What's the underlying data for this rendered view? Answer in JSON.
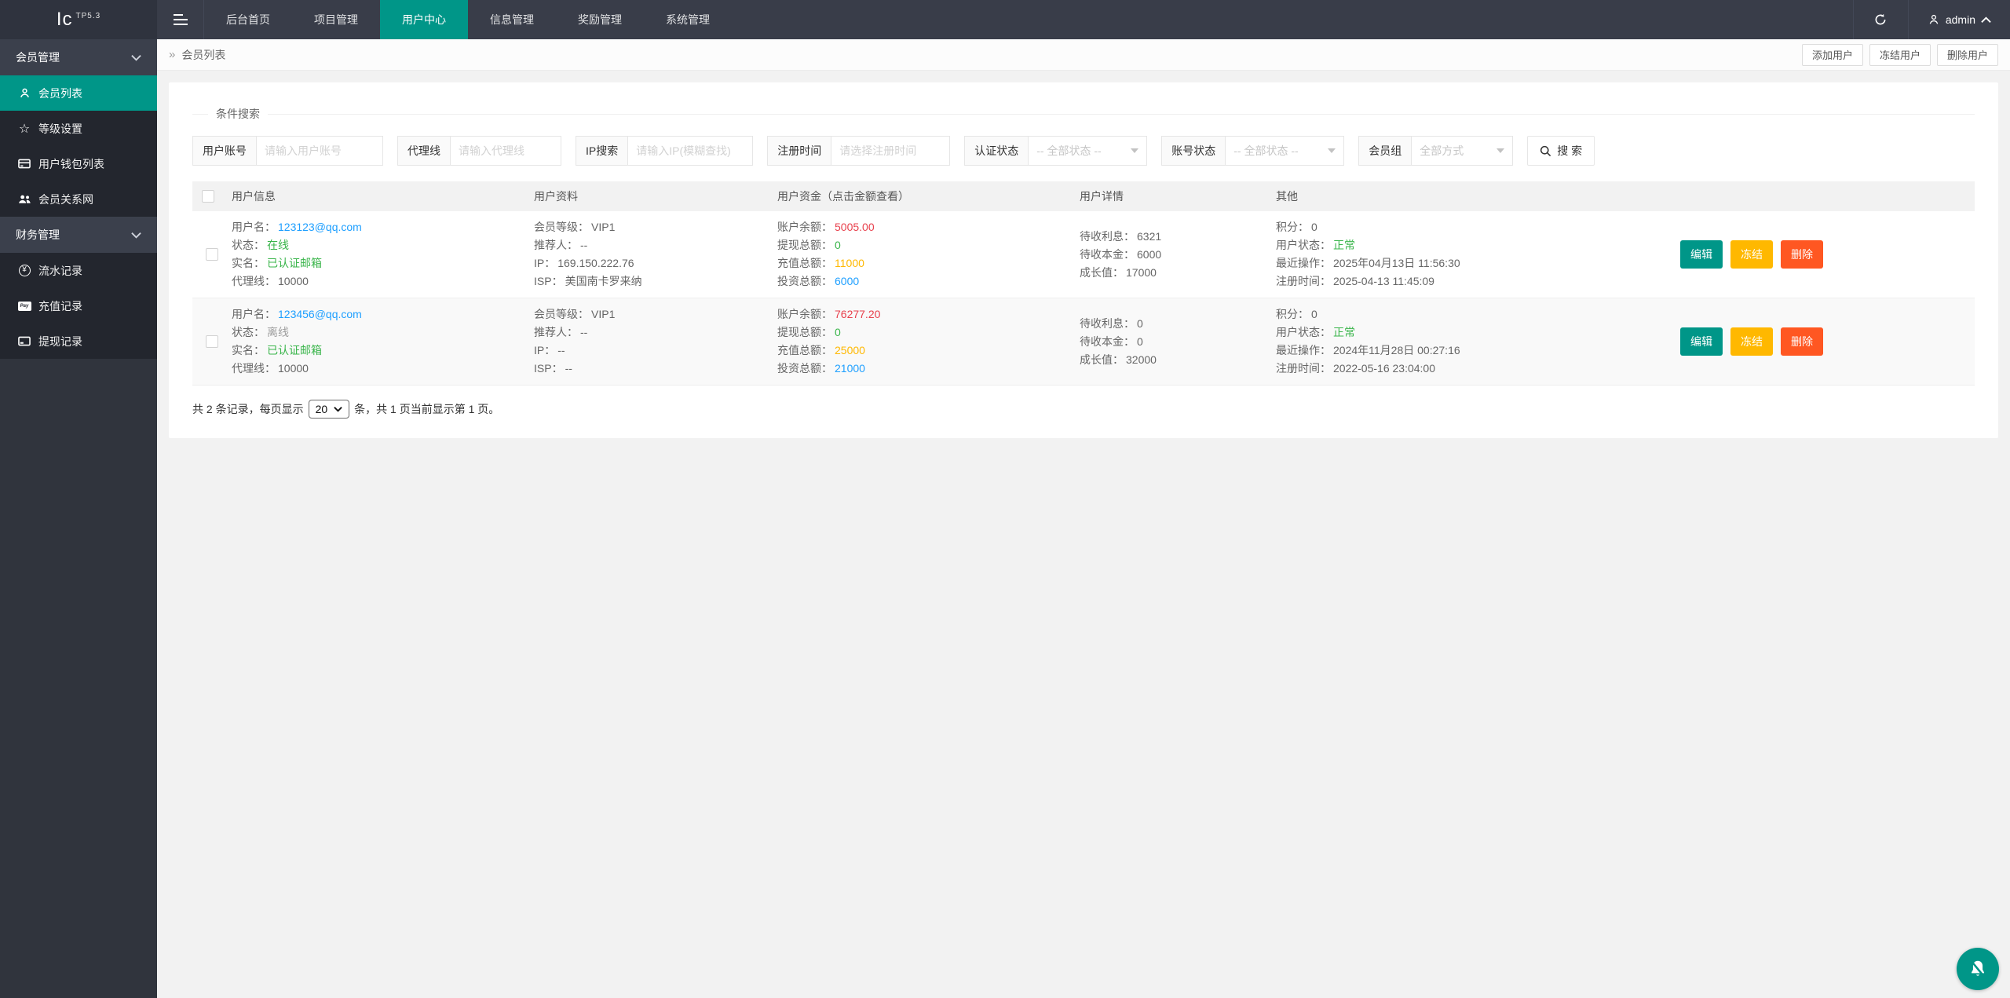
{
  "colors": {
    "accent": "#009688",
    "topbar_bg": "#393D49",
    "sidebar_items_bg": "#23262E",
    "link_blue": "#1E9FFF",
    "green": "#39b54a",
    "red": "#e8414d",
    "orange": "#FFB800",
    "danger_btn": "#FF5722",
    "gray": "#9e9e9e"
  },
  "icons": {
    "yen_glyph": "¥",
    "paypal_glyph": "Pay",
    "star_glyph": "☆",
    "list": [
      "hamburger-icon",
      "refresh-icon",
      "user-icon",
      "chevron-up-icon",
      "chevron-down-icon",
      "member-icon",
      "star-icon",
      "wallet-icon",
      "network-icon",
      "yen-icon",
      "paypal-icon",
      "withdraw-card-icon",
      "search-icon",
      "bell-slash-icon"
    ]
  },
  "topbar": {
    "logo_main": "Ic",
    "logo_sub": "TP5.3",
    "nav": [
      {
        "label": "后台首页"
      },
      {
        "label": "项目管理"
      },
      {
        "label": "用户中心"
      },
      {
        "label": "信息管理"
      },
      {
        "label": "奖励管理"
      },
      {
        "label": "系统管理"
      }
    ],
    "user": "admin"
  },
  "sidebar": {
    "groups": [
      {
        "label": "会员管理",
        "items": [
          {
            "label": "会员列表"
          },
          {
            "label": "等级设置"
          },
          {
            "label": "用户钱包列表"
          },
          {
            "label": "会员关系网"
          }
        ]
      },
      {
        "label": "财务管理",
        "items": [
          {
            "label": "流水记录"
          },
          {
            "label": "充值记录"
          },
          {
            "label": "提现记录"
          }
        ]
      }
    ]
  },
  "breadcrumb": {
    "separator": "»",
    "title": "会员列表"
  },
  "header_buttons": [
    "添加用户",
    "冻结用户",
    "删除用户"
  ],
  "search": {
    "legend": "条件搜索",
    "fields": [
      {
        "label": "用户账号",
        "placeholder": "请输入用户账号"
      },
      {
        "label": "代理线",
        "placeholder": "请输入代理线"
      },
      {
        "label": "IP搜索",
        "placeholder": "请输入IP(模糊查找)"
      },
      {
        "label": "注册时间",
        "placeholder": "请选择注册时间"
      },
      {
        "label": "认证状态",
        "value": "-- 全部状态 --"
      },
      {
        "label": "账号状态",
        "value": "-- 全部状态 --"
      },
      {
        "label": "会员组",
        "value": "全部方式"
      }
    ],
    "search_button": "搜 索"
  },
  "table": {
    "headers": [
      "用户信息",
      "用户资料",
      "用户资金（点击金额查看）",
      "用户详情",
      "其他"
    ],
    "labels": {
      "username": "用户名：",
      "status": "状态：",
      "realname": "实名：",
      "agent": "代理线：",
      "level": "会员等级：",
      "referrer": "推荐人：",
      "ip": "IP：",
      "isp": "ISP：",
      "balance": "账户余额：",
      "withdraw": "提现总额：",
      "recharge": "充值总额：",
      "invest": "投资总额：",
      "interest": "待收利息：",
      "principal": "待收本金：",
      "growth": "成长值：",
      "points": "积分：",
      "user_status": "用户状态：",
      "last_op": "最近操作：",
      "reg_time": "注册时间："
    },
    "actions": [
      "编辑",
      "冻结",
      "删除"
    ],
    "rows": [
      {
        "username": "123123@qq.com",
        "status": "在线",
        "realname": "已认证邮箱",
        "agent": "10000",
        "level": "VIP1",
        "referrer": "--",
        "ip": "169.150.222.76",
        "isp": "美国南卡罗来纳",
        "balance": "5005.00",
        "withdraw": "0",
        "recharge": "11000",
        "invest": "6000",
        "interest": "6321",
        "principal": "6000",
        "growth": "17000",
        "points": "0",
        "user_status": "正常",
        "last_op": "2025年04月13日 11:56:30",
        "reg_time": "2025-04-13 11:45:09"
      },
      {
        "username": "123456@qq.com",
        "status": "离线",
        "realname": "已认证邮箱",
        "agent": "10000",
        "level": "VIP1",
        "referrer": "--",
        "ip": "--",
        "isp": "--",
        "balance": "76277.20",
        "withdraw": "0",
        "recharge": "25000",
        "invest": "21000",
        "interest": "0",
        "principal": "0",
        "growth": "32000",
        "points": "0",
        "user_status": "正常",
        "last_op": "2024年11月28日 00:27:16",
        "reg_time": "2022-05-16 23:04:00"
      }
    ]
  },
  "pagination": {
    "prefix": "共 2 条记录，每页显示",
    "page_size": "20",
    "suffix": "条，共 1 页当前显示第 1 页。"
  }
}
